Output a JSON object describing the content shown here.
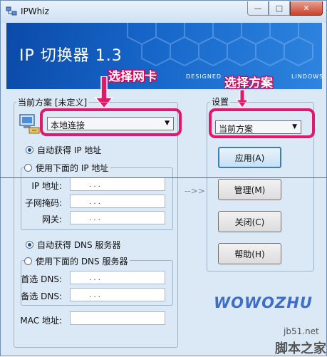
{
  "window": {
    "title": "IPWhiz",
    "minimize_glyph": "—",
    "maximize_glyph": "□",
    "close_glyph": "✕"
  },
  "banner": {
    "title": "IP 切换器 1.3",
    "designed_text": "DESIGNED",
    "windows_text": "LINDOWS)"
  },
  "annotations": {
    "select_nic": "选择网卡",
    "select_scheme": "选择方案"
  },
  "left_group": {
    "label": "当前方案 [未定义]",
    "nic_selected": "本地连接",
    "radio_auto_ip": "自动获得 IP 地址",
    "radio_manual_ip": "使用下面的 IP 地址",
    "ip_label": "IP 地址:",
    "mask_label": "子网掩码:",
    "gateway_label": "网关:",
    "radio_auto_dns": "自动获得 DNS 服务器",
    "radio_manual_dns": "使用下面的 DNS 服务器",
    "dns1_label": "首选 DNS:",
    "dns2_label": "备选 DNS:",
    "mac_label": "MAC 地址:",
    "ip_dots": ".      .      .",
    "mask_dots": ".      .      .",
    "gw_dots": ".      .      .",
    "dns1_dots": ".      .      .",
    "dns2_dots": ".      .      ."
  },
  "right_group": {
    "label": "设置",
    "scheme_selected": "当前方案",
    "apply": "应用(A)",
    "manage": "管理(M)",
    "close": "关闭(C)",
    "help": "帮助(H)"
  },
  "arrow_text": "-->>",
  "logo_text": "WOWOZHU",
  "watermark": {
    "site": "jb51.net",
    "brand": "脚本之家"
  },
  "colors": {
    "annotation": "#e0196a",
    "banner": "#1666c9"
  }
}
